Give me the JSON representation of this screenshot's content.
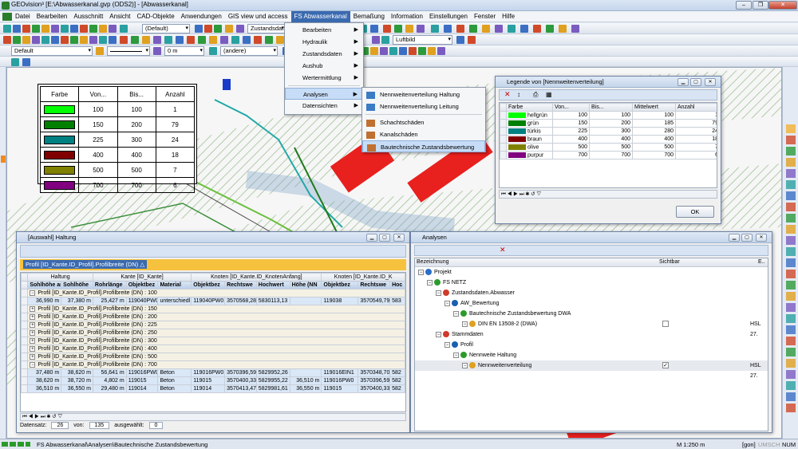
{
  "app": {
    "title": "GEOvision³  [E:\\Abwasserkanal.gvp (ODS2)] - [Abwasserkanal]",
    "window_controls": [
      "–",
      "❐",
      "✕"
    ]
  },
  "menu": [
    "Datei",
    "Bearbeiten",
    "Ausschnitt",
    "Ansicht",
    "CAD-Objekte",
    "Anwendungen",
    "GIS view und access",
    "FS Abwasserkanal",
    "Bemaßung",
    "Information",
    "Einstellungen",
    "Fenster",
    "Hilfe"
  ],
  "menu_active": "FS Abwasserkanal",
  "toolbar": {
    "layer_combo": "(Default)",
    "zust_combo": "Zustandsdat",
    "luftbild_combo": "Luftbild",
    "style_combo": "Default",
    "height_combo": "0 m",
    "andere_combo": "(andere)"
  },
  "fs_menu": {
    "items": [
      {
        "label": "Bearbeiten",
        "sub": true
      },
      {
        "label": "Hydraulik",
        "sub": true
      },
      {
        "label": "Zustandsdaten",
        "sub": true
      },
      {
        "label": "Aushub",
        "sub": true
      },
      {
        "label": "Wertermittlung",
        "sub": true
      },
      {
        "label": "Analysen",
        "sub": true
      },
      {
        "label": "Datensichten",
        "sub": true
      }
    ]
  },
  "analysen_submenu": [
    "Nennweitenverteilung Haltung",
    "Nennweitenverteilung Leitung",
    "Schachtschäden",
    "Kanalschäden",
    "Bautechnische Zustandsbewertung"
  ],
  "map_legend": {
    "headers": [
      "Farbe",
      "Von...",
      "Bis...",
      "Anzahl"
    ],
    "rows": [
      {
        "color": "#00ff00",
        "von": "100",
        "bis": "100",
        "anzahl": "1"
      },
      {
        "color": "#008000",
        "von": "150",
        "bis": "200",
        "anzahl": "79"
      },
      {
        "color": "#008080",
        "von": "225",
        "bis": "300",
        "anzahl": "24"
      },
      {
        "color": "#800000",
        "von": "400",
        "bis": "400",
        "anzahl": "18"
      },
      {
        "color": "#808000",
        "von": "500",
        "bis": "500",
        "anzahl": "7"
      },
      {
        "color": "#800080",
        "von": "700",
        "bis": "700",
        "anzahl": "6"
      }
    ]
  },
  "legend_dialog": {
    "title": "Legende von [Nennweitenverteilung]",
    "headers": [
      "Farbe",
      "Von...",
      "Bis...",
      "Mittelwert",
      "Anzahl"
    ],
    "rows": [
      {
        "color": "#00ff00",
        "name": "hellgrün",
        "von": "100",
        "bis": "100",
        "mittel": "100",
        "anzahl": "1"
      },
      {
        "color": "#008000",
        "name": "grün",
        "von": "150",
        "bis": "200",
        "mittel": "185",
        "anzahl": "79"
      },
      {
        "color": "#008080",
        "name": "türkis",
        "von": "225",
        "bis": "300",
        "mittel": "280",
        "anzahl": "24"
      },
      {
        "color": "#800000",
        "name": "braun",
        "von": "400",
        "bis": "400",
        "mittel": "400",
        "anzahl": "18"
      },
      {
        "color": "#808000",
        "name": "olive",
        "von": "500",
        "bis": "500",
        "mittel": "500",
        "anzahl": "7"
      },
      {
        "color": "#800080",
        "name": "purpur",
        "von": "700",
        "bis": "700",
        "mittel": "700",
        "anzahl": "6"
      }
    ],
    "ok": "OK"
  },
  "haltung": {
    "title": "[Auswahl] Haltung",
    "group_bar": "Profil [ID_Kante.ID_Profil].Profilbreite (DN)  △",
    "band_headers": [
      "Haltung",
      "Kante [ID_Kante]",
      "Knoten [ID_Kante.ID_KnotenAnfang]",
      "Knoten [ID_Kante.ID_K"
    ],
    "col_headers": [
      "Sohlhöhe am",
      "Sohlhöhe",
      "Rohrlänge",
      "Objektbez",
      "Material",
      "Objektbez",
      "Rechtswe",
      "Hochwert",
      "Höhe (NN",
      "Objektbez",
      "Rechtswe",
      "Hoc"
    ],
    "group_label": "Profil [ID_Kante.ID_Profil].Profilbreite (DN) : ",
    "groups": [
      "100",
      "150",
      "200",
      "225",
      "250",
      "300",
      "400",
      "500",
      "700"
    ],
    "row100": [
      "36,990 m",
      "37,380 m",
      "25,427 m",
      "119040PW0",
      "unterschiedl",
      "119040PW0",
      "3570568,28",
      "5830113,13",
      "",
      "119038",
      "3570549,79",
      "583"
    ],
    "rows700": [
      [
        "37,480 m",
        "38,620 m",
        "56,641 m",
        "119016PW0",
        "Beton",
        "119016PW0",
        "3570396,59",
        "5829952,26",
        "",
        "119016EIN1",
        "3570348,70",
        "582"
      ],
      [
        "38,620 m",
        "38,720 m",
        "4,802 m",
        "119015",
        "Beton",
        "119015",
        "3570400,33",
        "5829955,22",
        "36,510 m",
        "119016PW0",
        "3570396,59",
        "582"
      ],
      [
        "36,510 m",
        "36,550 m",
        "29,480 m",
        "119014",
        "Beton",
        "119014",
        "3570413,47",
        "5829981,61",
        "36,550 m",
        "119015",
        "3570400,33",
        "582"
      ]
    ],
    "footer": {
      "ds_label": "Datensatz:",
      "ds": "26",
      "von_label": "von:",
      "von": "135",
      "ausg_label": "ausgewählt:",
      "ausg": "0"
    }
  },
  "analysen": {
    "title": "Analysen",
    "headers": [
      "Bezeichnung",
      "Sichtbar",
      "E.."
    ],
    "tree": [
      {
        "label": "Projekt",
        "lvl": 0
      },
      {
        "label": "FS NETZ",
        "lvl": 1
      },
      {
        "label": "Zustandsdaten.Abwasser",
        "lvl": 2
      },
      {
        "label": "AW_Bewertung",
        "lvl": 3
      },
      {
        "label": "Bautechnische Zustandsbewertung DWA",
        "lvl": 4
      },
      {
        "label": "DIN EN 13508-2 (DWA)",
        "lvl": 5,
        "check": "",
        "extra": "HSL 27."
      },
      {
        "label": "Stammdaten",
        "lvl": 2
      },
      {
        "label": "Profil",
        "lvl": 3
      },
      {
        "label": "Nennweite Haltung",
        "lvl": 4
      },
      {
        "label": "Nennweitenverteilung",
        "lvl": 5,
        "check": "✓",
        "extra": "HSL 27."
      }
    ]
  },
  "status": {
    "text": "FS Abwasserkanal\\Analysen\\Bautechnische Zustandsbewertung",
    "scale": "M 1:250  m",
    "gon": "[gon]",
    "umsch": "UMSCH",
    "num": "NUM"
  }
}
